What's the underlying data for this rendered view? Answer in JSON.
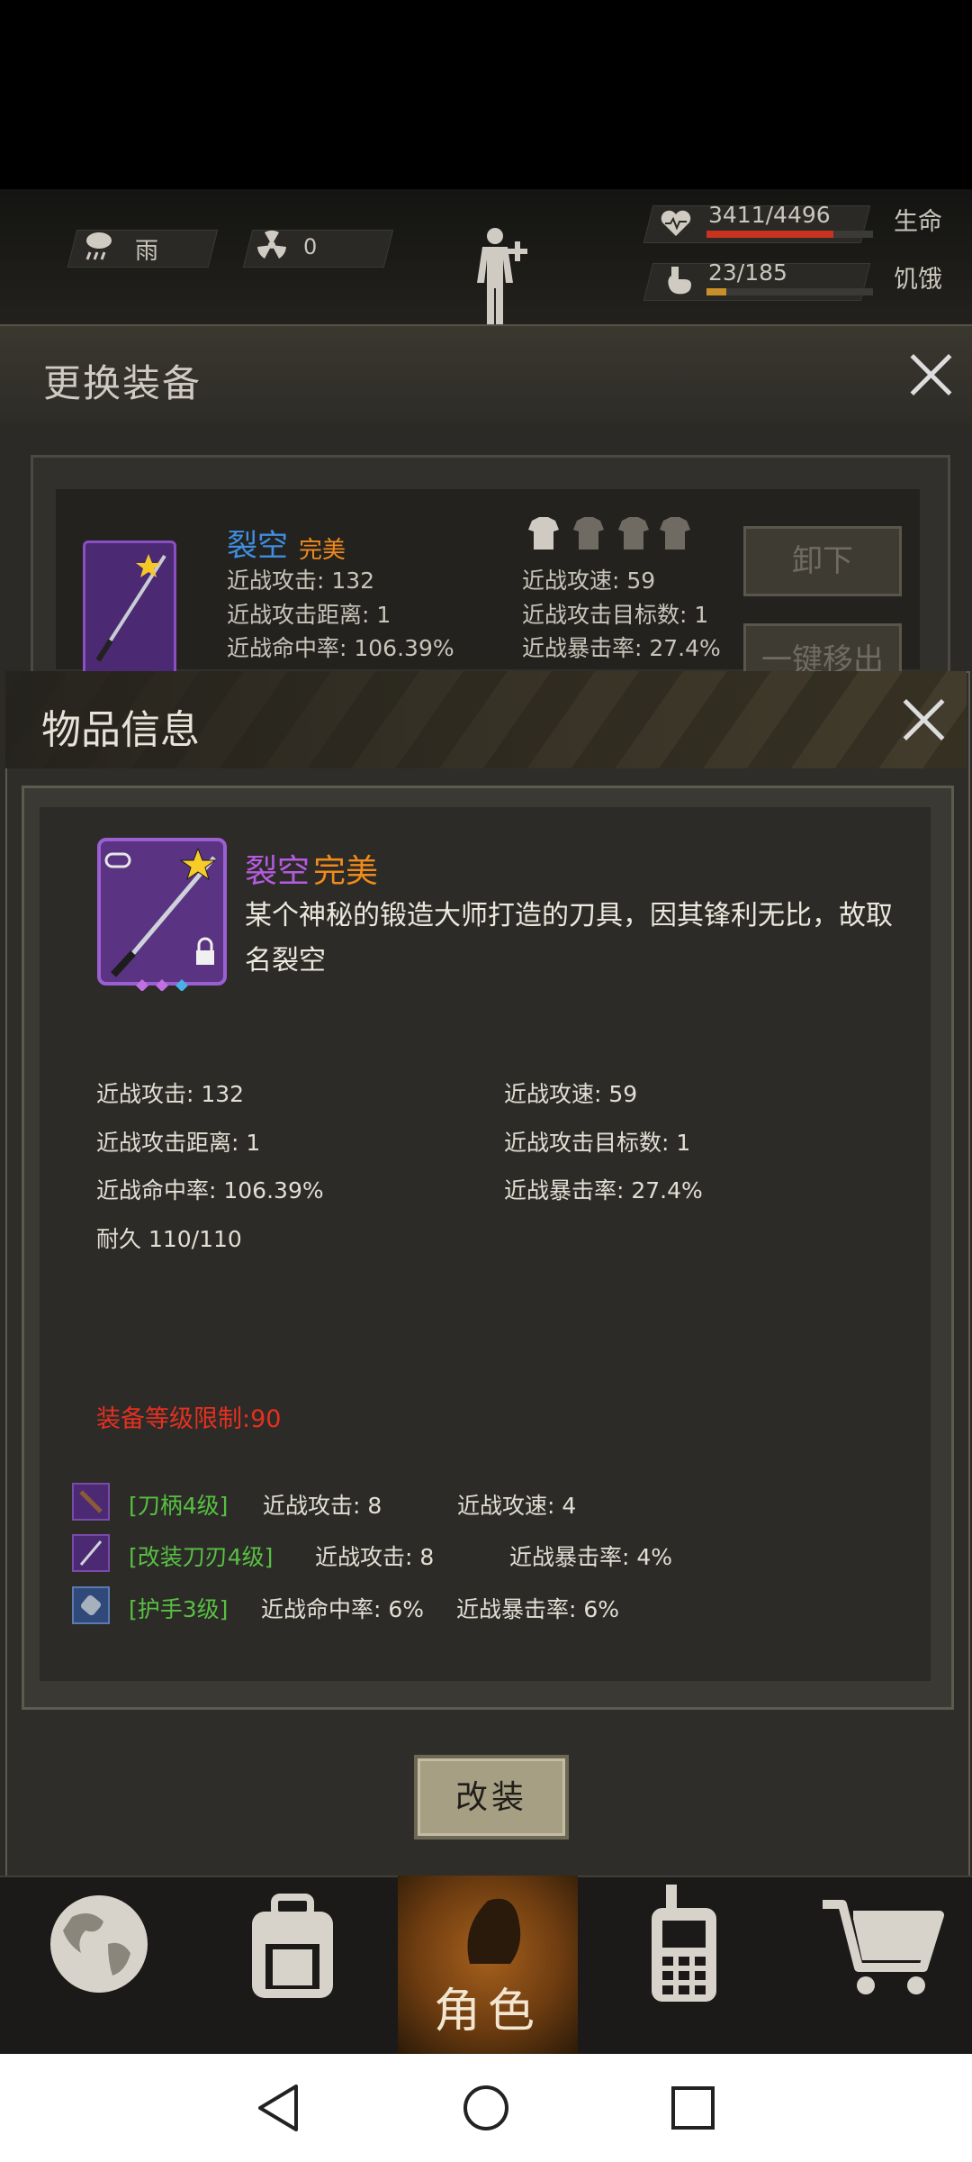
{
  "status_bar": {
    "weather": "雨",
    "radiation": "0",
    "health": {
      "value": "3411/4496",
      "label": "生命",
      "fraction": 0.76
    },
    "hunger": {
      "value": "23/185",
      "label": "饥饿",
      "fraction": 0.12
    }
  },
  "equip_panel": {
    "title": "更换装备",
    "item_name": "裂空",
    "item_quality": "完美",
    "stats": {
      "melee_attack": "近战攻击: 132",
      "melee_range": "近战攻击距离: 1",
      "melee_accuracy": "近战命中率: 106.39%",
      "melee_speed": "近战攻速: 59",
      "melee_targets": "近战攻击目标数: 1",
      "melee_crit": "近战暴击率: 27.4%"
    },
    "unequip_label": "卸下",
    "remove_all_label": "一键移出"
  },
  "dialog": {
    "title": "物品信息",
    "item_name": "裂空",
    "item_quality": "完美",
    "description": "某个神秘的锻造大师打造的刀具，因其锋利无比，故取名裂空",
    "stats": {
      "melee_attack": "近战攻击: 132",
      "melee_speed": "近战攻速: 59",
      "melee_range": "近战攻击距离: 1",
      "melee_targets": "近战攻击目标数: 1",
      "melee_accuracy": "近战命中率: 106.39%",
      "melee_crit": "近战暴击率: 27.4%",
      "durability": "耐久 110/110"
    },
    "level_limit": "装备等级限制:90",
    "mods": [
      {
        "name": "[刀柄4级]",
        "stat1": "近战攻击: 8",
        "stat2": "近战攻速: 4"
      },
      {
        "name": "[改装刀刃4级]",
        "stat1": "近战攻击: 8",
        "stat2": "近战暴击率: 4%"
      },
      {
        "name": "[护手3级]",
        "stat1": "近战命中率: 6%",
        "stat2": "近战暴击率: 6%"
      }
    ],
    "modify_button": "改装"
  },
  "bottom_nav": {
    "active_label": "角色",
    "items": [
      "globe-icon",
      "backpack-icon",
      "character-icon",
      "radio-icon",
      "cart-icon"
    ]
  },
  "colors": {
    "item_name": "#b65be0",
    "quality": "#f08a1c",
    "level_limit": "#e53020",
    "mod_name": "#58c043",
    "health_bar": "#c8321e",
    "hunger_bar": "#c9902a"
  }
}
